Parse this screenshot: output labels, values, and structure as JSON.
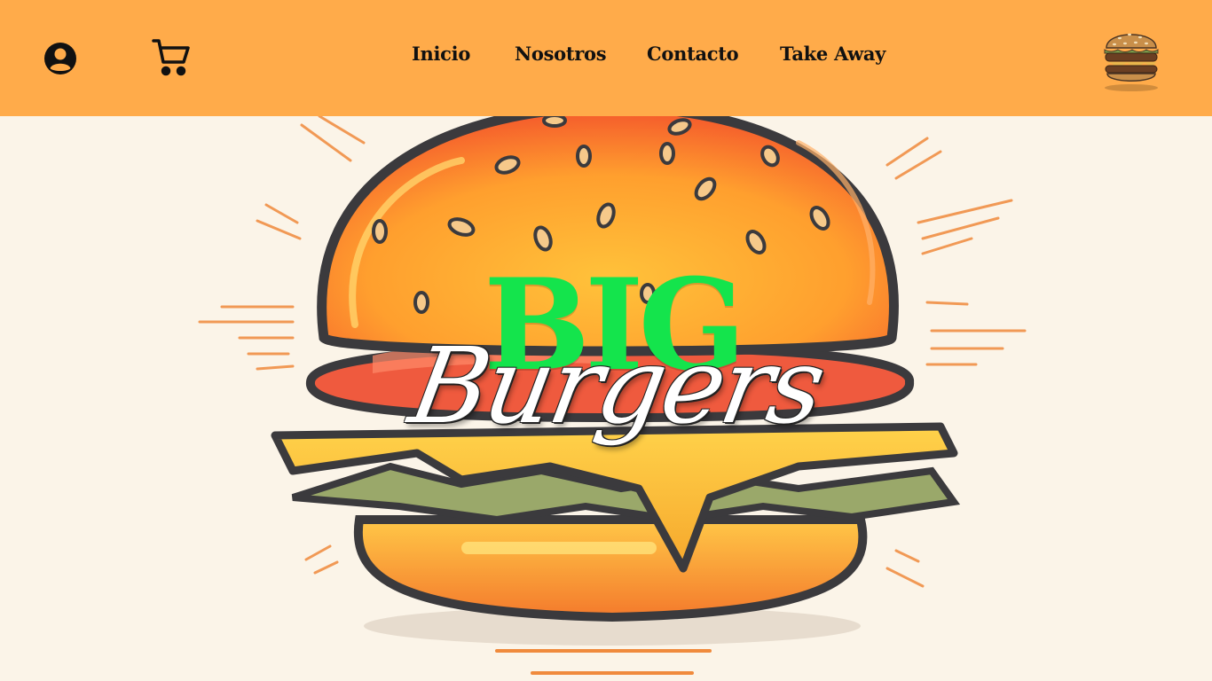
{
  "header": {
    "nav": [
      {
        "label": "Inicio"
      },
      {
        "label": "Nosotros"
      },
      {
        "label": "Contacto"
      },
      {
        "label": "Take Away"
      }
    ],
    "icons": {
      "account": "user-circle-icon",
      "cart": "shopping-cart-icon",
      "logo": "burger-logo"
    },
    "colors": {
      "bar": "#ffab4a",
      "text": "#111111"
    }
  },
  "hero": {
    "title_top": "BIG",
    "title_script": "Burgers",
    "colors": {
      "title_top": "#14e44c",
      "title_script": "#ffffff",
      "background": "#fbf4e8"
    }
  }
}
